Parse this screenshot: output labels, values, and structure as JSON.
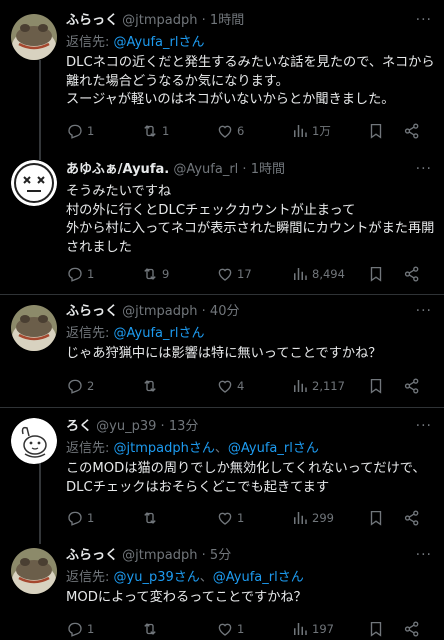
{
  "tweets": [
    {
      "name": "ふらっく",
      "handle": "@jtmpadph",
      "time": "1時間",
      "reply_prefix": "返信先: ",
      "mentions": [
        "@Ayufa_rlさん"
      ],
      "lines": [
        "DLCネコの近くだと発生するみたいな話を見たので、ネコから",
        "離れた場合どうなるか気になります。",
        "スージャが軽いのはネコがいないからとか聞きました。"
      ],
      "stats": {
        "replies": "1",
        "retweets": "1",
        "likes": "6",
        "views": "1万"
      }
    },
    {
      "name": "あゆふぁ/Ayufa.",
      "handle": "@Ayufa_rl",
      "time": "1時間",
      "reply_prefix": "",
      "mentions": [],
      "lines": [
        "そうみたいですね",
        "村の外に行くとDLCチェックカウントが止まって",
        "外から村に入ってネコが表示された瞬間にカウントがまた再開",
        "されました"
      ],
      "stats": {
        "replies": "1",
        "retweets": "9",
        "likes": "17",
        "views": "8,494"
      }
    },
    {
      "name": "ふらっく",
      "handle": "@jtmpadph",
      "time": "40分",
      "reply_prefix": "返信先: ",
      "mentions": [
        "@Ayufa_rlさん"
      ],
      "lines": [
        "じゃあ狩猟中には影響は特に無いってことですかね？"
      ],
      "stats": {
        "replies": "2",
        "retweets": "",
        "likes": "4",
        "views": "2,117"
      }
    },
    {
      "name": "ろく",
      "handle": "@yu_p39",
      "time": "13分",
      "reply_prefix": "返信先: ",
      "mentions": [
        "@jtmpadphさん",
        "@Ayufa_rlさん"
      ],
      "mention_sep": "、",
      "lines": [
        "このMODは猫の周りでしか無効化してくれないってだけで、",
        "DLCチェックはおそらくどこでも起きてます"
      ],
      "stats": {
        "replies": "1",
        "retweets": "",
        "likes": "1",
        "views": "299"
      }
    },
    {
      "name": "ふらっく",
      "handle": "@jtmpadph",
      "time": "5分",
      "reply_prefix": "返信先: ",
      "mentions": [
        "@yu_p39さん",
        "@Ayufa_rlさん"
      ],
      "mention_sep": "、",
      "lines": [
        "MODによって変わるってことですかね？"
      ],
      "stats": {
        "replies": "1",
        "retweets": "",
        "likes": "1",
        "views": "197"
      }
    }
  ],
  "ui": {
    "dot": "·",
    "more": "···",
    "icons": [
      "more-icon",
      "reply-icon",
      "retweet-icon",
      "like-icon",
      "views-icon",
      "bookmark-icon",
      "share-icon"
    ]
  },
  "colors": {
    "background": "#000000",
    "text": "#e7e9ea",
    "secondary": "#71767b",
    "mention": "#1d9bf0",
    "divider": "#2f3336"
  }
}
